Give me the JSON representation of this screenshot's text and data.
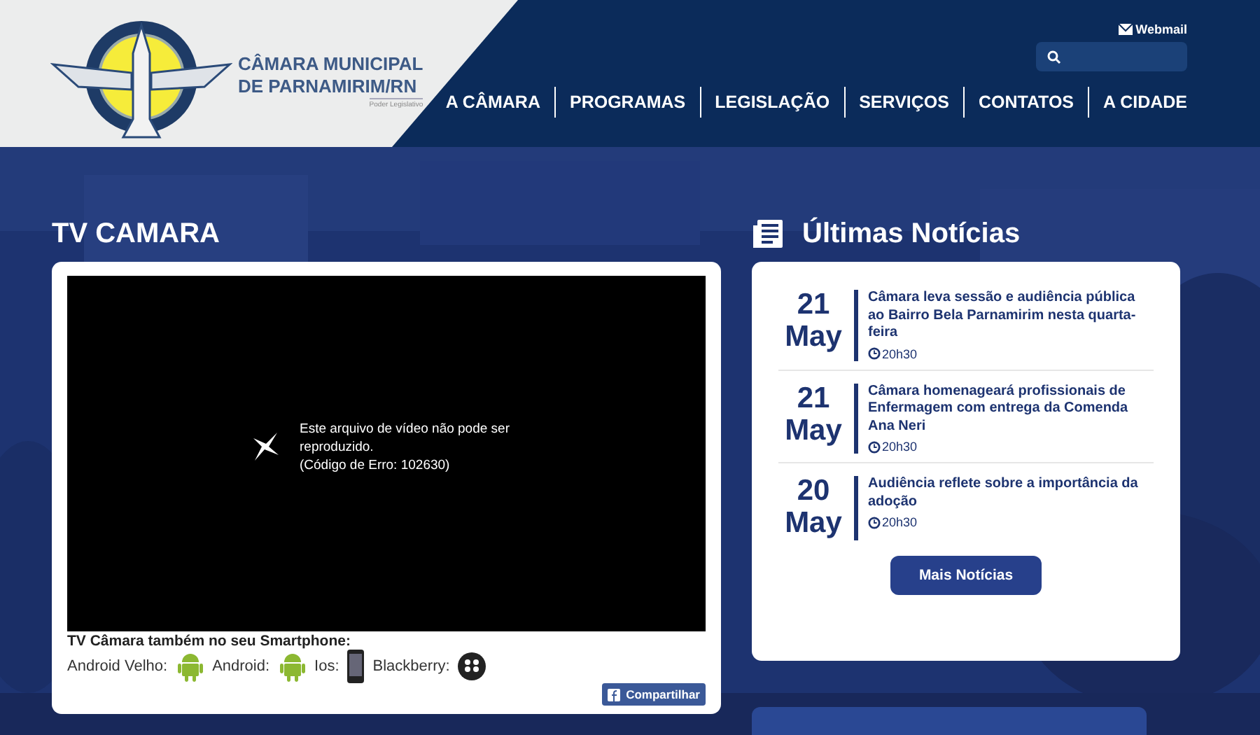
{
  "header": {
    "logo_lines": [
      "CÂMARA MUNICIPAL",
      "DE PARNAMIRIM/RN"
    ],
    "logo_tagline": "Poder Legislativo",
    "webmail": "Webmail",
    "nav": [
      "A CÂMARA",
      "PROGRAMAS",
      "LEGISLAÇÃO",
      "SERVIÇOS",
      "CONTATOS",
      "A CIDADE"
    ]
  },
  "tv": {
    "title": "TV CAMARA",
    "error_lines": [
      "Este arquivo de vídeo não pode ser",
      "reproduzido.",
      "(Código de Erro: 102630)"
    ],
    "smartphone_heading": "TV Câmara também no seu Smartphone:",
    "apps": [
      {
        "label": "Android Velho:",
        "kind": "android"
      },
      {
        "label": "Android:",
        "kind": "android"
      },
      {
        "label": "Ios:",
        "kind": "iphone"
      },
      {
        "label": "Blackberry:",
        "kind": "blackberry"
      }
    ],
    "share": "Compartilhar"
  },
  "news": {
    "title": "Últimas Notícias",
    "items": [
      {
        "day": "21",
        "month": "May",
        "headline": "Câmara leva sessão e audiência pública ao Bairro Bela Parnamirim nesta quarta-feira",
        "time": "20h30"
      },
      {
        "day": "21",
        "month": "May",
        "headline": "Câmara homenageará profissionais de Enfermagem com entrega da Comenda Ana Neri",
        "time": "20h30"
      },
      {
        "day": "20",
        "month": "May",
        "headline": "Audiência reflete sobre a importância da adoção",
        "time": "20h30"
      }
    ],
    "more": "Mais Notícias"
  }
}
